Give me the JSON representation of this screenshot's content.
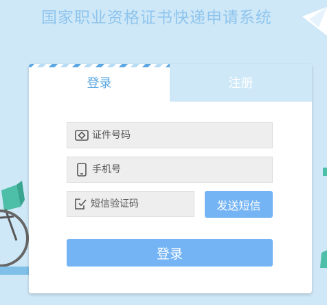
{
  "header": {
    "title": "国家职业资格证书快递申请系统"
  },
  "tabs": {
    "login": "登录",
    "register": "注册"
  },
  "form": {
    "id_number_placeholder": "证件号码",
    "phone_placeholder": "手机号",
    "sms_code_placeholder": "短信验证码",
    "send_sms_label": "发送短信",
    "login_label": "登录"
  },
  "colors": {
    "background": "#cfe8f7",
    "accent": "#74b4f4",
    "title": "#8fc5ee"
  }
}
